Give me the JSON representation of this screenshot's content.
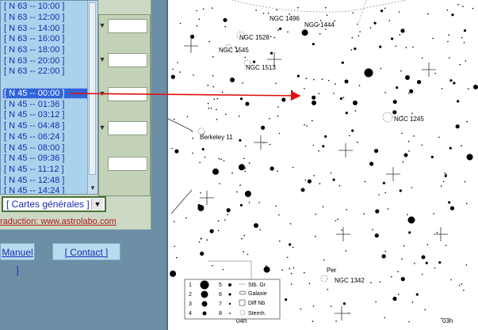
{
  "list": {
    "items": [
      "[ N 63 -- 10:00 ]",
      "[ N 63 -- 12:00 ]",
      "[ N 63 -- 14:00 ]",
      "[ N 63 -- 16:00 ]",
      "[ N 63 -- 18:00 ]",
      "[ N 63 -- 20:00 ]",
      "[ N 63 -- 22:00 ]",
      "",
      "[ N 45 -- 00:00 ]",
      "[ N 45 -- 01:36 ]",
      "[ N 45 -- 03:12 ]",
      "[ N 45 -- 04:48 ]",
      "[ N 45 -- 06:24 ]",
      "[ N 45 -- 08:00 ]",
      "[ N 45 -- 09:36 ]",
      "[ N 45 -- 11:12 ]",
      "[ N 45 -- 12:48 ]",
      "[ N 45 -- 14:24 ]"
    ],
    "selected_index": 8
  },
  "select": {
    "value": "[ Cartes générales ]"
  },
  "footer": {
    "traduction": "raduction: www.astrolabo.com"
  },
  "nav": {
    "manuel": "Manuel ]",
    "contact": "[ Contact ]"
  },
  "map": {
    "labels": {
      "ngc1496": "NGC 1496",
      "ngc1444": "NGC 1444",
      "ngc1528": "NGC 1528",
      "ngc1545": "NGC 1545",
      "ngc1513": "NGC 1513",
      "ngc1245": "NGC 1245",
      "berkeley11": "Berkeley 11",
      "per": "Per",
      "ngc1342": "NGC 1342",
      "ra04": "04h",
      "ra03": "03h"
    },
    "legend": {
      "mags": [
        "1",
        "2",
        "3",
        "4",
        "5",
        "6",
        "7",
        "8"
      ],
      "types": [
        "Stb. Gr",
        "Galaxie",
        "Diff Nb",
        "Sternh."
      ]
    },
    "colors": {
      "arrow": "#e01010",
      "star": "#000000"
    }
  }
}
